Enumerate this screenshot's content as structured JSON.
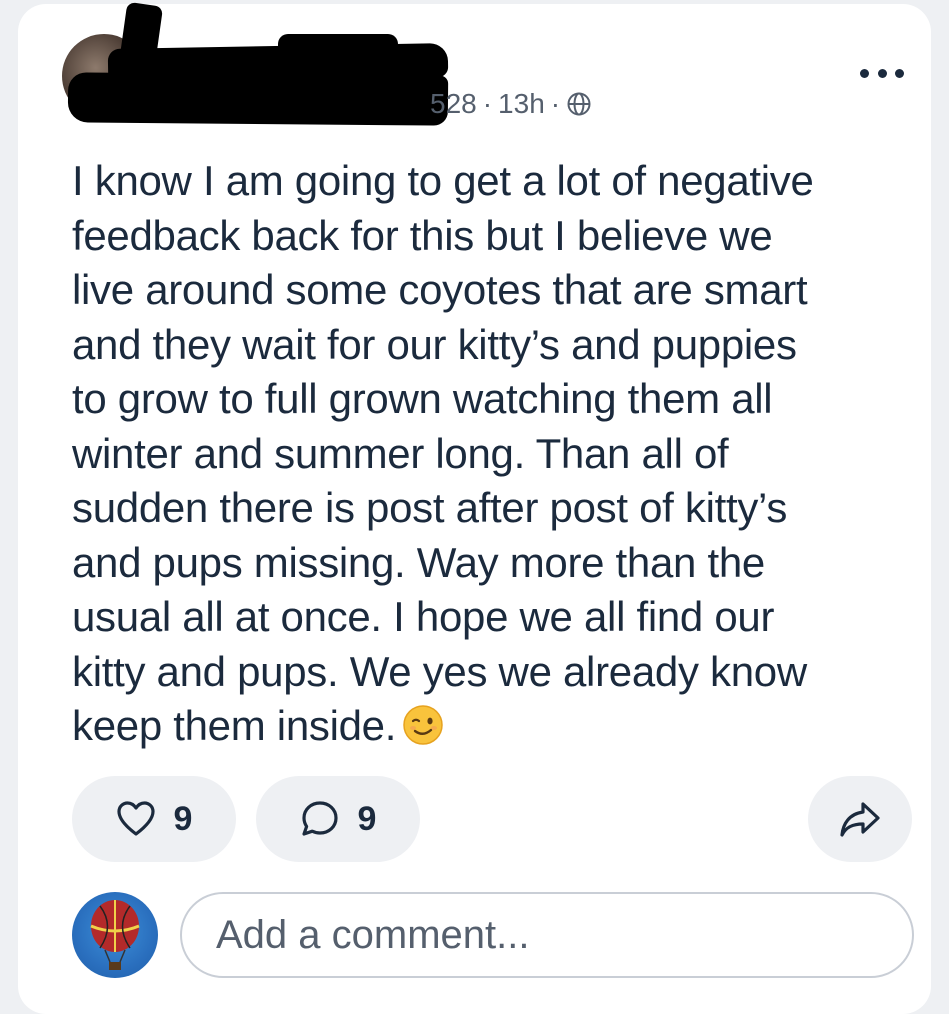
{
  "post": {
    "meta_fragment": "528",
    "time": "13h",
    "separator": "·",
    "body": "I know I am going to get a lot of negative\nfeedback back for this but I believe we\nlive around some coyotes that are smart\nand they wait for our kitty’s and puppies\nto grow to full grown watching them all\nwinter and summer long. Than all of\nsudden there is post after post of kitty’s\nand pups missing. Way more than the\nusual all at once. I hope we all find our\nkitty and pups. We yes we already know\nkeep them inside.",
    "emoji": "winking-face"
  },
  "actions": {
    "like_count": "9",
    "comment_count": "9"
  },
  "comment_box": {
    "placeholder": "Add a comment..."
  },
  "icons": {
    "more": "more-horizontal-icon",
    "globe": "globe-icon",
    "like": "heart-icon",
    "comment": "comment-bubble-icon",
    "share": "share-arrow-icon"
  },
  "colors": {
    "text": "#1b2a3d",
    "secondary_text": "#555f6d",
    "pill_bg": "#eef0f3",
    "page_bg": "#eef0f3",
    "card_bg": "#ffffff"
  }
}
